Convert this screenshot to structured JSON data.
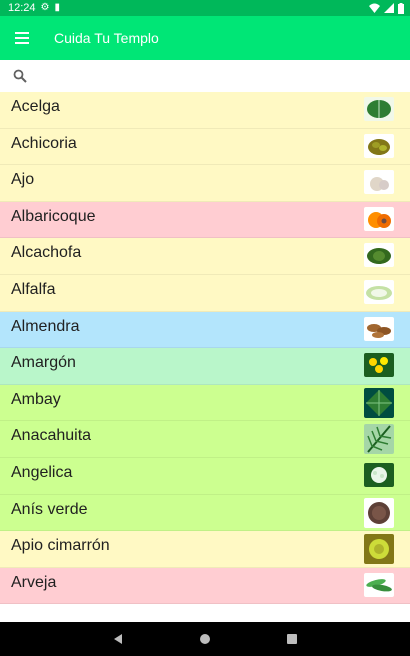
{
  "status_bar": {
    "time": "12:24"
  },
  "app_bar": {
    "title": "Cuida Tu Templo",
    "menu_icon": "hamburger-menu-icon"
  },
  "search": {
    "icon": "search-icon",
    "value": "",
    "placeholder": ""
  },
  "colors": {
    "status_bar": "#00b85a",
    "app_bar": "#00e676",
    "yellow": "#fff9c4",
    "red": "#ffcdd2",
    "blue": "#b3e5fc",
    "mint": "#b9f6ca",
    "lime": "#ccff90"
  },
  "items": [
    {
      "label": "Acelga",
      "color": "#fff9c4",
      "thumb": "chard-leaf"
    },
    {
      "label": "Achicoria",
      "color": "#fff9c4",
      "thumb": "chicory"
    },
    {
      "label": "Ajo",
      "color": "#fff9c4",
      "thumb": "garlic"
    },
    {
      "label": "Albaricoque",
      "color": "#ffcdd2",
      "thumb": "apricot"
    },
    {
      "label": "Alcachofa",
      "color": "#fff9c4",
      "thumb": "artichoke"
    },
    {
      "label": "Alfalfa",
      "color": "#fff9c4",
      "thumb": "alfalfa"
    },
    {
      "label": "Almendra",
      "color": "#b3e5fc",
      "thumb": "almond"
    },
    {
      "label": "Amargón",
      "color": "#b9f6ca",
      "thumb": "dandelion"
    },
    {
      "label": "Ambay",
      "color": "#ccff90",
      "thumb": "ambay-leaf"
    },
    {
      "label": "Anacahuita",
      "color": "#ccff90",
      "thumb": "fern-leaf"
    },
    {
      "label": "Angelica",
      "color": "#ccff90",
      "thumb": "angelica-flower"
    },
    {
      "label": "Anís verde",
      "color": "#ccff90",
      "thumb": "anise-seeds"
    },
    {
      "label": "Apio cimarrón",
      "color": "#fff9c4",
      "thumb": "wild-celery"
    },
    {
      "label": "Arveja",
      "color": "#ffcdd2",
      "thumb": "peas"
    }
  ],
  "nav": {
    "back": "back-triangle-icon",
    "home": "home-circle-icon",
    "recents": "recents-square-icon"
  }
}
